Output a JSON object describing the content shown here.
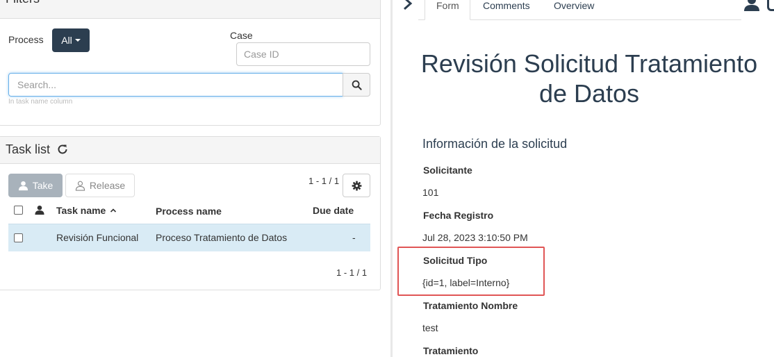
{
  "filters": {
    "title": "Filters",
    "process_label": "Process",
    "process_value": "All",
    "case_label": "Case",
    "case_placeholder": "Case ID",
    "search_placeholder": "Search...",
    "search_hint": "In task name column"
  },
  "tasklist": {
    "title": "Task list",
    "take_label": "Take",
    "release_label": "Release",
    "pager_top": "1 - 1 / 1",
    "pager_bottom": "1 - 1 / 1",
    "columns": [
      "Task name",
      "Process name",
      "Due date"
    ],
    "rows": [
      {
        "task_name": "Revisión Funcional",
        "process_name": "Proceso Tratamiento de Datos",
        "due_date": "-"
      }
    ]
  },
  "right": {
    "tabs": [
      "Form",
      "Comments",
      "Overview"
    ],
    "active_tab": "Form",
    "form_title_line1": "Revisión Solicitud Tratamiento",
    "form_title_line2": "de Datos",
    "section": "Información de la solicitud",
    "fields": [
      {
        "label": "Solicitante",
        "value": "101"
      },
      {
        "label": "Fecha Registro",
        "value": "Jul 28, 2023 3:10:50 PM"
      },
      {
        "label": "Solicitud Tipo",
        "value": "{id=1, label=Interno}"
      },
      {
        "label": "Tratamiento Nombre",
        "value": "test"
      },
      {
        "label": "Tratamiento",
        "value": ""
      }
    ]
  },
  "colors": {
    "primary": "#2c3e50",
    "selected_row": "#d9ebf5",
    "highlight": "#e05555"
  },
  "icons": [
    "refresh-icon",
    "search-icon",
    "user-icon",
    "gear-icon",
    "sort-up-icon",
    "chevron-right-icon"
  ]
}
